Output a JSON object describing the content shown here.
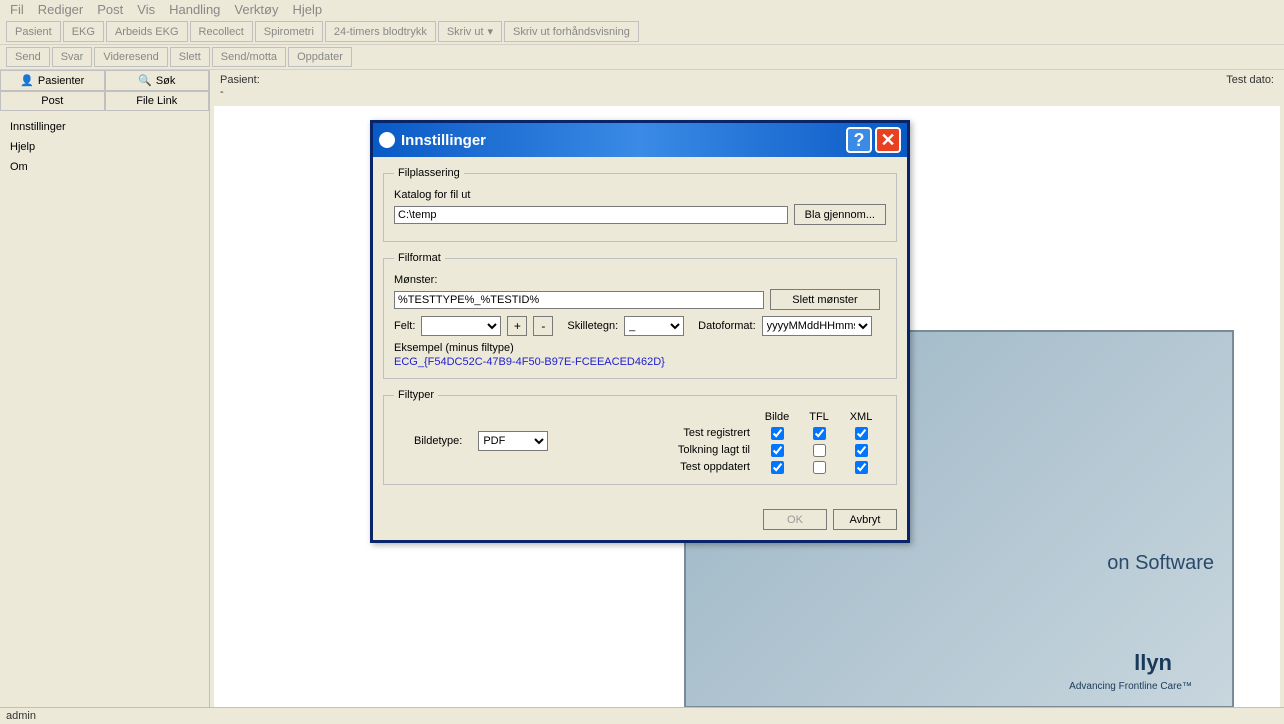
{
  "menubar": [
    "Fil",
    "Rediger",
    "Post",
    "Vis",
    "Handling",
    "Verktøy",
    "Hjelp"
  ],
  "toolbar1": [
    "Pasient",
    "EKG",
    "Arbeids EKG",
    "Recollect",
    "Spirometri",
    "24-timers blodtrykk",
    "Skriv ut",
    "Skriv ut forhåndsvisning"
  ],
  "toolbar2": [
    "Send",
    "Svar",
    "Videresend",
    "Slett",
    "Send/motta",
    "Oppdater"
  ],
  "sidebar": {
    "tab_pasienter": "Pasienter",
    "tab_sok": "Søk",
    "subtab_post": "Post",
    "subtab_filelink": "File Link",
    "items": [
      "Innstillinger",
      "Hjelp",
      "Om"
    ]
  },
  "header": {
    "pasient_label": "Pasient:",
    "pasient_value": "-",
    "testdato_label": "Test dato:"
  },
  "software": {
    "text": "on Software",
    "brand": "llyn",
    "tagline": "Advancing Frontline Care™"
  },
  "dialog": {
    "title": "Innstillinger",
    "filplassering": {
      "legend": "Filplassering",
      "katalog_label": "Katalog for fil ut",
      "katalog_value": "C:\\temp",
      "browse": "Bla gjennom..."
    },
    "filformat": {
      "legend": "Filformat",
      "monster_label": "Mønster:",
      "monster_value": "%TESTTYPE%_%TESTID%",
      "slett_monster": "Slett mønster",
      "felt_label": "Felt:",
      "plus": "+",
      "minus": "-",
      "skilletegn_label": "Skilletegn:",
      "skilletegn_value": "_",
      "datoformat_label": "Datoformat:",
      "datoformat_value": "yyyyMMddHHmms",
      "eksempel_label": "Eksempel (minus filtype)",
      "eksempel_value": "ECG_{F54DC52C-47B9-4F50-B97E-FCEEACED462D}"
    },
    "filtyper": {
      "legend": "Filtyper",
      "bildetype_label": "Bildetype:",
      "bildetype_value": "PDF",
      "col_bilde": "Bilde",
      "col_tfl": "TFL",
      "col_xml": "XML",
      "row_test_registrert": "Test registrert",
      "row_tolkning": "Tolkning lagt til",
      "row_test_oppdatert": "Test oppdatert",
      "checks": {
        "r1": [
          true,
          true,
          true
        ],
        "r2": [
          true,
          false,
          true
        ],
        "r3": [
          true,
          false,
          true
        ]
      }
    },
    "ok": "OK",
    "avbryt": "Avbryt"
  },
  "status": "admin"
}
